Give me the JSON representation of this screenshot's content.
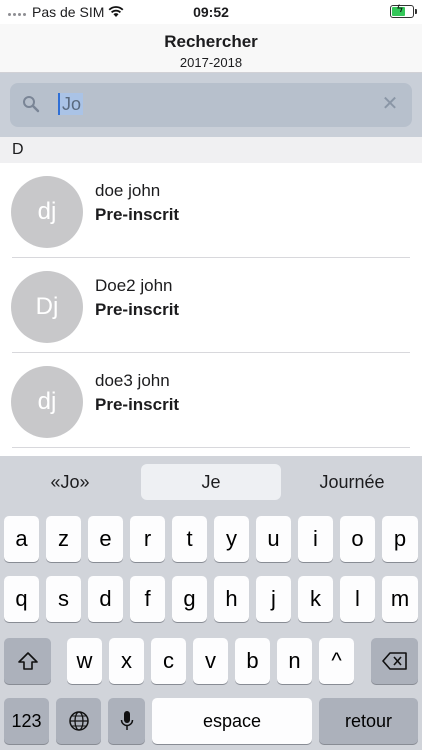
{
  "statusbar": {
    "carrier": "Pas de SIM",
    "time": "09:52",
    "battery_level": 0.7,
    "battery_color": "#34c759"
  },
  "navbar": {
    "title": "Rechercher",
    "subtitle": "2017-2018"
  },
  "search": {
    "value": "Jo"
  },
  "section": {
    "header": "D"
  },
  "results": [
    {
      "initials": "dj",
      "name": "doe john",
      "status": "Pre-inscrit"
    },
    {
      "initials": "Dj",
      "name": "Doe2 john",
      "status": "Pre-inscrit"
    },
    {
      "initials": "dj",
      "name": "doe3 john",
      "status": "Pre-inscrit"
    }
  ],
  "keyboard": {
    "suggestions": [
      "«Jo»",
      "Je",
      "Journée"
    ],
    "row1": [
      "a",
      "z",
      "e",
      "r",
      "t",
      "y",
      "u",
      "i",
      "o",
      "p"
    ],
    "row2": [
      "q",
      "s",
      "d",
      "f",
      "g",
      "h",
      "j",
      "k",
      "l",
      "m"
    ],
    "row3": [
      "w",
      "x",
      "c",
      "v",
      "b",
      "n",
      "^"
    ],
    "numbers_label": "123",
    "space_label": "espace",
    "return_label": "retour"
  }
}
